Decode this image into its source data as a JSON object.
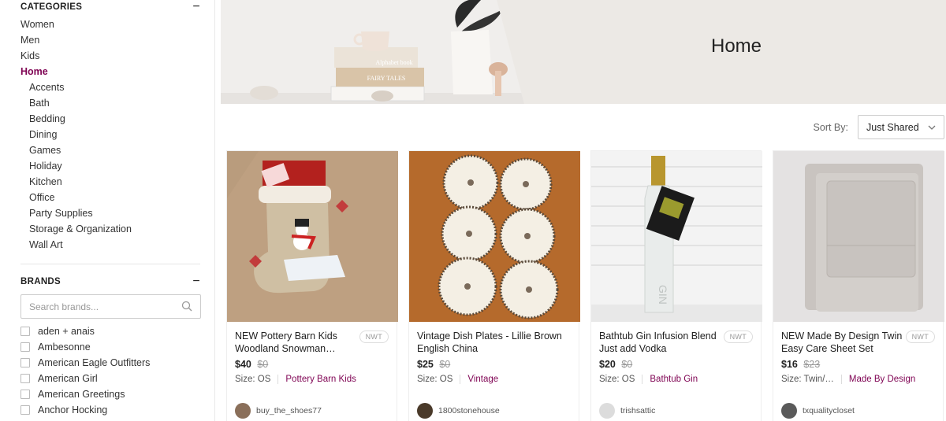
{
  "sidebar": {
    "categories_title": "CATEGORIES",
    "categories_toggle": "−",
    "categories": [
      {
        "label": "Women"
      },
      {
        "label": "Men"
      },
      {
        "label": "Kids"
      },
      {
        "label": "Home"
      }
    ],
    "subcategories": [
      {
        "label": "Accents"
      },
      {
        "label": "Bath"
      },
      {
        "label": "Bedding"
      },
      {
        "label": "Dining"
      },
      {
        "label": "Games"
      },
      {
        "label": "Holiday"
      },
      {
        "label": "Kitchen"
      },
      {
        "label": "Office"
      },
      {
        "label": "Party Supplies"
      },
      {
        "label": "Storage & Organization"
      },
      {
        "label": "Wall Art"
      }
    ],
    "brands_title": "BRANDS",
    "brands_toggle": "−",
    "brand_search_placeholder": "Search brands...",
    "brands": [
      {
        "label": "aden + anais"
      },
      {
        "label": "Ambesonne"
      },
      {
        "label": "American Eagle Outfitters"
      },
      {
        "label": "American Girl"
      },
      {
        "label": "American Greetings"
      },
      {
        "label": "Anchor Hocking"
      }
    ]
  },
  "hero": {
    "title": "Home"
  },
  "sort": {
    "label": "Sort By:",
    "selected": "Just Shared"
  },
  "listings": [
    {
      "title": "NEW Pottery Barn Kids Woodland Snowman…",
      "badge": "NWT",
      "price": "$40",
      "original_price": "$0",
      "size": "Size: OS",
      "brand": "Pottery Barn Kids",
      "seller": "buy_the_shoes77"
    },
    {
      "title": "Vintage Dish Plates - Lillie Brown English China",
      "badge": "",
      "price": "$25",
      "original_price": "$0",
      "size": "Size: OS",
      "brand": "Vintage",
      "seller": "1800stonehouse"
    },
    {
      "title": "Bathtub Gin Infusion Blend Just add Vodka",
      "badge": "NWT",
      "price": "$20",
      "original_price": "$0",
      "size": "Size: OS",
      "brand": "Bathtub Gin",
      "seller": "trishsattic"
    },
    {
      "title": "NEW Made By Design Twin Easy Care Sheet Set",
      "badge": "NWT",
      "price": "$16",
      "original_price": "$23",
      "size": "Size: Twin/…",
      "brand": "Made By Design",
      "seller": "txqualitycloset"
    }
  ],
  "colors": {
    "accent": "#7f0353",
    "hero_bg": "#ece9e5"
  }
}
